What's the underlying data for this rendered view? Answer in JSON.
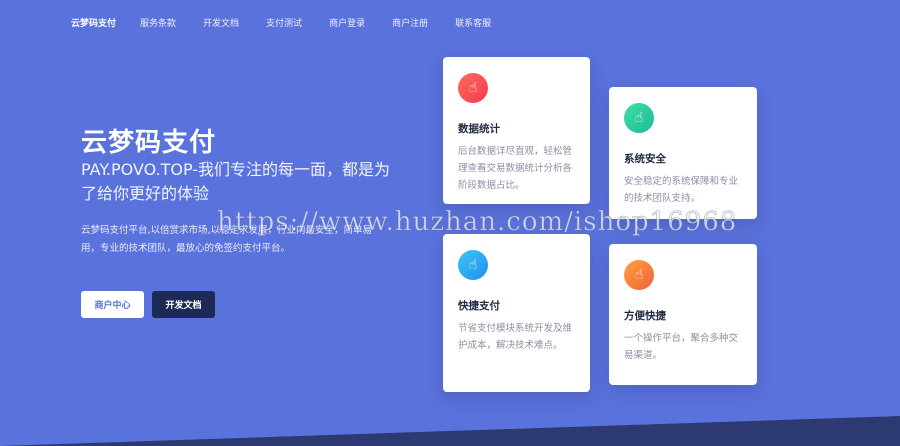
{
  "nav": {
    "brand": "云梦码支付",
    "items": [
      "服务条款",
      "开发文档",
      "支付测试",
      "商户登录",
      "商户注册",
      "联系客服"
    ]
  },
  "hero": {
    "title": "云梦码支付",
    "subtitle": "PAY.POVO.TOP-我们专注的每一面，都是为了给你更好的体验",
    "description": "云梦码支付平台,以倍赏求市场,以稳定求发展，行业内最安全，简单易用，专业的技术团队，最放心的免签约支付平台。",
    "btn_merchant": "商户中心",
    "btn_dev": "开发文档"
  },
  "cards": [
    {
      "title": "数据统计",
      "text": "后台数据详尽直观，轻松管理查看交易数据统计分析各阶段数据占比。",
      "icon": "pointer-hand-icon",
      "color": "#f23c4f"
    },
    {
      "title": "系统安全",
      "text": "安全稳定的系统保障和专业的技术团队支持。",
      "icon": "pointer-hand-icon",
      "color": "#1fb89a"
    },
    {
      "title": "快捷支付",
      "text": "节省支付模块系统开发及维护成本，解决技术难点。",
      "icon": "pointer-hand-icon",
      "color": "#1f8ef0"
    },
    {
      "title": "方便快捷",
      "text": "一个操作平台，聚合多种交易渠道。",
      "icon": "pointer-hand-icon",
      "color": "#f2603a"
    }
  ],
  "watermark": "https://www.huzhan.com/ishop16968",
  "colors": {
    "background": "#5a72dc",
    "dark_button": "#1e2a56"
  }
}
